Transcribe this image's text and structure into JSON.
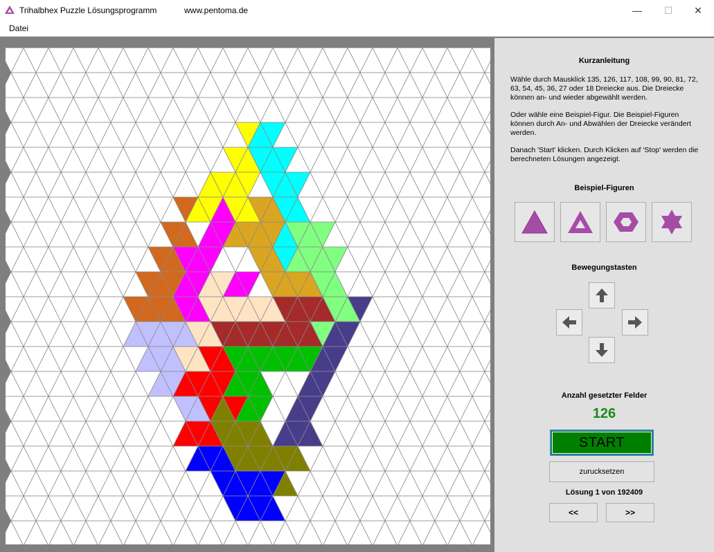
{
  "window": {
    "title": "Trihalbhex Puzzle Lösungsprogramm",
    "url": "www.pentoma.de",
    "controls": {
      "minimize": "—",
      "maximize": "☐",
      "close": "✕"
    }
  },
  "menu": {
    "items": [
      "Datei"
    ]
  },
  "panel": {
    "heading": "Kurzanleitung",
    "instructions": [
      "Wähle durch Mausklick 135, 126, 117, 108, 99, 90, 81, 72, 63, 54, 45, 36, 27 oder 18  Dreiecke aus. Die Dreiecke können an- und wieder abgewählt werden.",
      "Oder wähle eine Beispiel-Figur. Die Beispiel-Figuren können durch An- und Abwählen der Dreiecke verändert werden.",
      "Danach 'Start' klicken. Durch Klicken auf 'Stop' werden die berechneten Lösungen angezeigt."
    ],
    "examples_title": "Beispiel-Figuren",
    "examples": [
      {
        "name": "triangle-filled",
        "icon": "triangle-icon"
      },
      {
        "name": "triangle-hollow",
        "icon": "triangle-hollow-icon"
      },
      {
        "name": "hexagon-ring",
        "icon": "hexagon-icon"
      },
      {
        "name": "star",
        "icon": "star-icon"
      }
    ],
    "movement_title": "Bewegungstasten",
    "arrows": {
      "up": "arrow-up-icon",
      "left": "arrow-left-icon",
      "right": "arrow-right-icon",
      "down": "arrow-down-icon"
    },
    "count_label": "Anzahl gesetzter Felder",
    "count_value": "126",
    "start_label": "START",
    "reset_label": "zurucksetzen",
    "solution_text": "Lösung  1 von  192409",
    "prev_label": "<<",
    "next_label": ">>"
  },
  "colors": {
    "accent_purple": "#a64ca6",
    "start_green": "#008000",
    "count_green": "#1a8a1a",
    "board_bg": "#7f7f7f",
    "grid_line": "#8a8a8a"
  },
  "board": {
    "grid": {
      "rows": 20,
      "cols": 39
    },
    "pieces": [
      {
        "color": "#ffff00",
        "cells": [
          [
            3,
            18
          ],
          [
            4,
            17
          ],
          [
            4,
            18
          ],
          [
            5,
            15
          ],
          [
            5,
            16
          ],
          [
            5,
            17
          ],
          [
            5,
            18
          ],
          [
            6,
            14
          ],
          [
            6,
            15
          ],
          [
            6,
            16
          ],
          [
            6,
            17
          ],
          [
            6,
            18
          ]
        ]
      },
      {
        "color": "#00ffff",
        "cells": [
          [
            3,
            19
          ],
          [
            3,
            20
          ],
          [
            4,
            19
          ],
          [
            4,
            20
          ],
          [
            4,
            21
          ],
          [
            5,
            20
          ],
          [
            5,
            21
          ],
          [
            5,
            22
          ],
          [
            6,
            21
          ],
          [
            6,
            22
          ],
          [
            7,
            21
          ],
          [
            8,
            21
          ]
        ]
      },
      {
        "color": "#d2691e",
        "cells": [
          [
            6,
            13
          ],
          [
            7,
            12
          ],
          [
            7,
            13
          ],
          [
            8,
            11
          ],
          [
            8,
            12
          ],
          [
            9,
            10
          ],
          [
            9,
            11
          ],
          [
            9,
            12
          ],
          [
            10,
            9
          ],
          [
            10,
            10
          ],
          [
            10,
            11
          ],
          [
            10,
            12
          ]
        ]
      },
      {
        "color": "#ff00ff",
        "cells": [
          [
            6,
            16
          ],
          [
            7,
            15
          ],
          [
            7,
            16
          ],
          [
            8,
            13
          ],
          [
            8,
            14
          ],
          [
            8,
            15
          ],
          [
            9,
            13
          ],
          [
            9,
            14
          ],
          [
            9,
            17
          ],
          [
            9,
            18
          ],
          [
            10,
            13
          ],
          [
            10,
            14
          ]
        ]
      },
      {
        "color": "#daa520",
        "cells": [
          [
            6,
            19
          ],
          [
            6,
            20
          ],
          [
            7,
            17
          ],
          [
            7,
            18
          ],
          [
            7,
            19
          ],
          [
            7,
            20
          ],
          [
            8,
            19
          ],
          [
            8,
            20
          ],
          [
            9,
            20
          ],
          [
            9,
            21
          ],
          [
            9,
            22
          ],
          [
            9,
            23
          ]
        ]
      },
      {
        "color": "#80ff80",
        "cells": [
          [
            7,
            22
          ],
          [
            7,
            23
          ],
          [
            7,
            24
          ],
          [
            8,
            22
          ],
          [
            8,
            23
          ],
          [
            8,
            24
          ],
          [
            8,
            25
          ],
          [
            9,
            24
          ],
          [
            9,
            25
          ],
          [
            10,
            25
          ],
          [
            10,
            26
          ],
          [
            11,
            24
          ]
        ]
      },
      {
        "color": "#ffe4c4",
        "cells": [
          [
            9,
            15
          ],
          [
            9,
            16
          ],
          [
            10,
            15
          ],
          [
            10,
            16
          ],
          [
            10,
            17
          ],
          [
            10,
            18
          ],
          [
            10,
            19
          ],
          [
            10,
            20
          ],
          [
            11,
            14
          ],
          [
            11,
            15
          ],
          [
            12,
            13
          ],
          [
            12,
            14
          ]
        ]
      },
      {
        "color": "#a52a2a",
        "cells": [
          [
            10,
            21
          ],
          [
            10,
            22
          ],
          [
            10,
            23
          ],
          [
            10,
            24
          ],
          [
            11,
            16
          ],
          [
            11,
            17
          ],
          [
            11,
            18
          ],
          [
            11,
            19
          ],
          [
            11,
            20
          ],
          [
            11,
            21
          ],
          [
            11,
            22
          ],
          [
            11,
            23
          ]
        ]
      },
      {
        "color": "#483d8b",
        "cells": [
          [
            10,
            27
          ],
          [
            11,
            25
          ],
          [
            11,
            26
          ],
          [
            12,
            24
          ],
          [
            12,
            25
          ],
          [
            13,
            23
          ],
          [
            13,
            24
          ],
          [
            14,
            22
          ],
          [
            14,
            23
          ],
          [
            15,
            21
          ],
          [
            15,
            22
          ],
          [
            15,
            23
          ]
        ]
      },
      {
        "color": "#c0c0ff",
        "cells": [
          [
            11,
            9
          ],
          [
            11,
            10
          ],
          [
            11,
            11
          ],
          [
            11,
            12
          ],
          [
            11,
            13
          ],
          [
            12,
            10
          ],
          [
            12,
            11
          ],
          [
            12,
            12
          ],
          [
            13,
            11
          ],
          [
            13,
            12
          ],
          [
            14,
            13
          ],
          [
            14,
            14
          ]
        ]
      },
      {
        "color": "#ff0000",
        "cells": [
          [
            12,
            15
          ],
          [
            12,
            16
          ],
          [
            13,
            13
          ],
          [
            13,
            14
          ],
          [
            13,
            15
          ],
          [
            13,
            16
          ],
          [
            14,
            15
          ],
          [
            14,
            16
          ],
          [
            14,
            17
          ],
          [
            15,
            13
          ],
          [
            15,
            14
          ],
          [
            15,
            15
          ]
        ]
      },
      {
        "color": "#00c000",
        "cells": [
          [
            12,
            17
          ],
          [
            12,
            18
          ],
          [
            12,
            19
          ],
          [
            12,
            20
          ],
          [
            12,
            21
          ],
          [
            12,
            22
          ],
          [
            12,
            23
          ],
          [
            13,
            17
          ],
          [
            13,
            18
          ],
          [
            13,
            19
          ],
          [
            14,
            18
          ],
          [
            14,
            19
          ]
        ]
      },
      {
        "color": "#808000",
        "cells": [
          [
            14,
            16
          ],
          [
            15,
            16
          ],
          [
            15,
            17
          ],
          [
            15,
            18
          ],
          [
            15,
            19
          ],
          [
            16,
            17
          ],
          [
            16,
            18
          ],
          [
            16,
            19
          ],
          [
            16,
            20
          ],
          [
            16,
            21
          ],
          [
            16,
            22
          ],
          [
            17,
            21
          ]
        ]
      },
      {
        "color": "#0000ff",
        "cells": [
          [
            16,
            14
          ],
          [
            16,
            15
          ],
          [
            16,
            16
          ],
          [
            17,
            16
          ],
          [
            17,
            17
          ],
          [
            17,
            18
          ],
          [
            17,
            19
          ],
          [
            17,
            20
          ],
          [
            18,
            17
          ],
          [
            18,
            18
          ],
          [
            18,
            19
          ],
          [
            18,
            20
          ]
        ]
      }
    ]
  }
}
